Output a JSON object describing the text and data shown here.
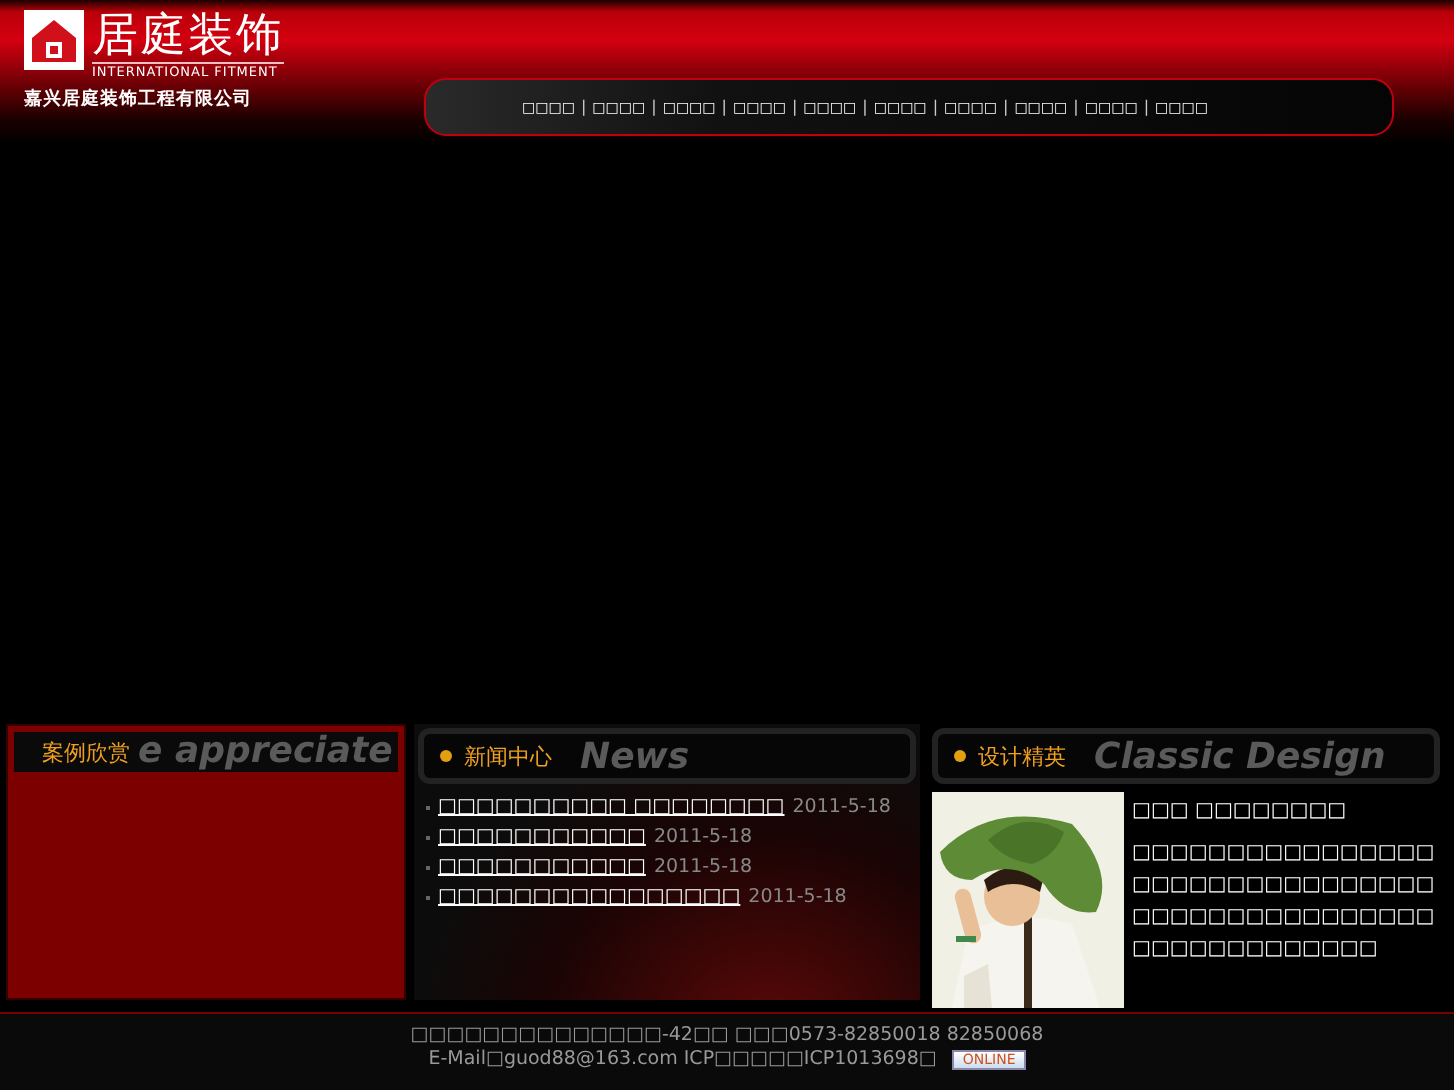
{
  "header": {
    "logo_title": "居庭装饰",
    "logo_subtitle": "INTERNATIONAL FITMENT",
    "company": "嘉兴居庭装饰工程有限公司"
  },
  "nav": [
    {
      "label": "□□□□"
    },
    {
      "separator": "|",
      "label": "□□□□"
    },
    {
      "separator": "|",
      "label": "□□□□"
    },
    {
      "separator": "|",
      "label": "□□□□"
    },
    {
      "separator": "|",
      "label": "□□□□"
    },
    {
      "separator": "|",
      "label": "□□□□"
    },
    {
      "separator": "|",
      "label": "□□□□"
    },
    {
      "separator": "|",
      "label": "□□□□"
    },
    {
      "separator": "|",
      "label": "□□□□"
    },
    {
      "separator": "|",
      "label": "□□□□"
    }
  ],
  "cases": {
    "title": "案例欣赏",
    "watermark": "e appreciate"
  },
  "news": {
    "title": "新闻中心",
    "watermark": "News",
    "items": [
      {
        "title": "□□□□□□□□□□ □□□□□□□□",
        "date": "2011-5-18"
      },
      {
        "title": "□□□□□□□□□□□",
        "date": "2011-5-18"
      },
      {
        "title": "□□□□□□□□□□□",
        "date": "2011-5-18"
      },
      {
        "title": "□□□□□□□□□□□□□□□□",
        "date": "2011-5-18"
      }
    ]
  },
  "design": {
    "title": "设计精英",
    "watermark": "Classic Design",
    "name": "□□□ □□□□□□□□",
    "text": "□□□□□□□□□□□□□□□□□□□□□□□□□□□□□□□□□□□□□□□□□□□□□□□□□□□□□□□□□□□□□"
  },
  "footer": {
    "lines": [
      "□□□□□□□□□□□□□□-42□□ □□□0573-82850018 82850068",
      "E-Mail□guod88@163.com ICP□□□□□ICP1013698□"
    ],
    "badge": "ONLINE"
  }
}
